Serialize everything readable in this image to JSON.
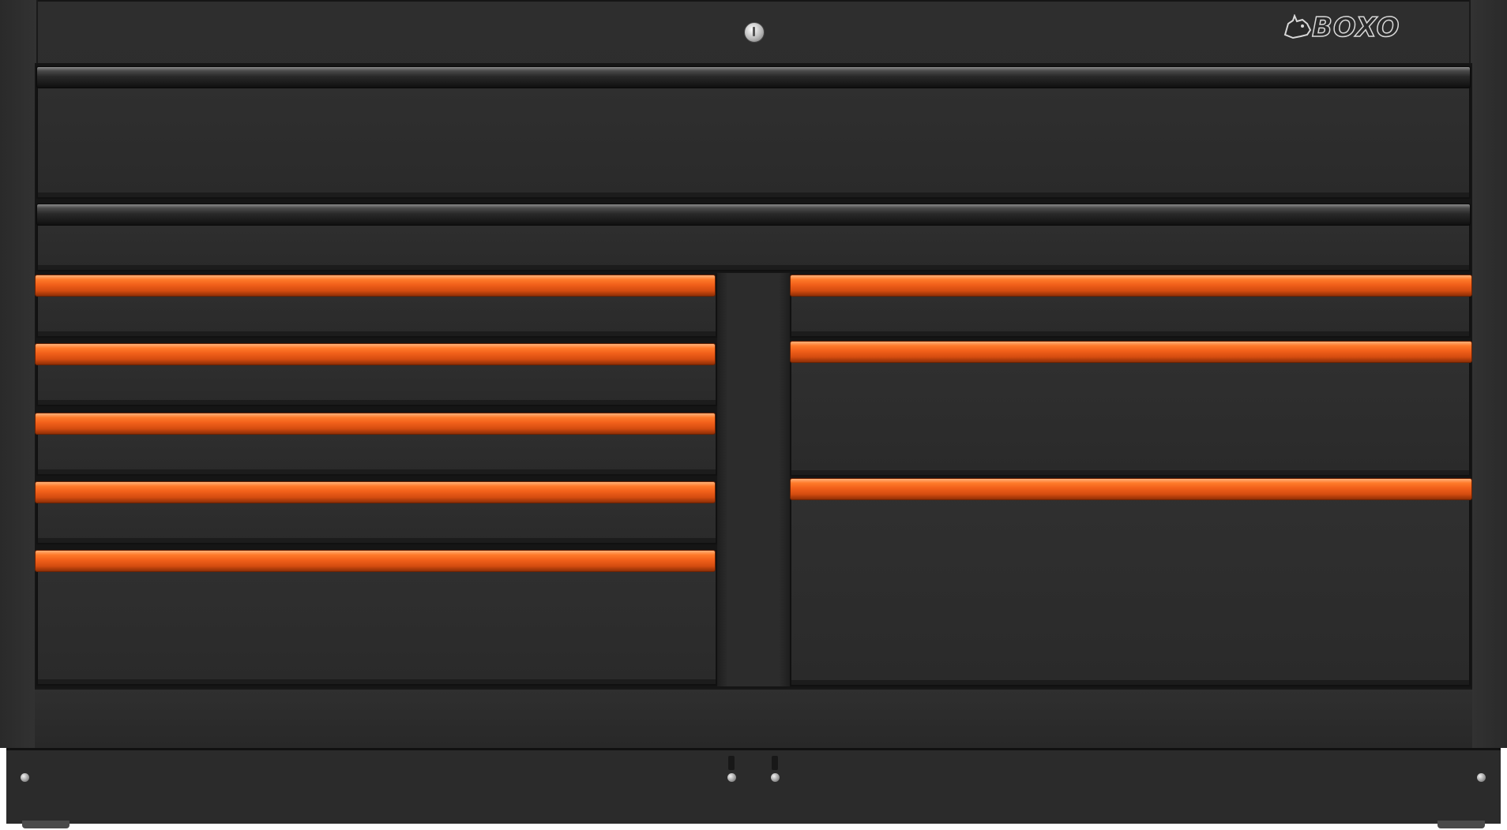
{
  "product": {
    "brand_logo": "BOXO",
    "body_color": "#2b2b2b",
    "handle_colors": {
      "top_drawers": "#1e1e1e",
      "lower_drawers": "#f2601a"
    }
  },
  "layout_summary": {
    "top_full_width_drawers": 2,
    "left_column_drawers": 5,
    "right_column_drawers": 3
  }
}
